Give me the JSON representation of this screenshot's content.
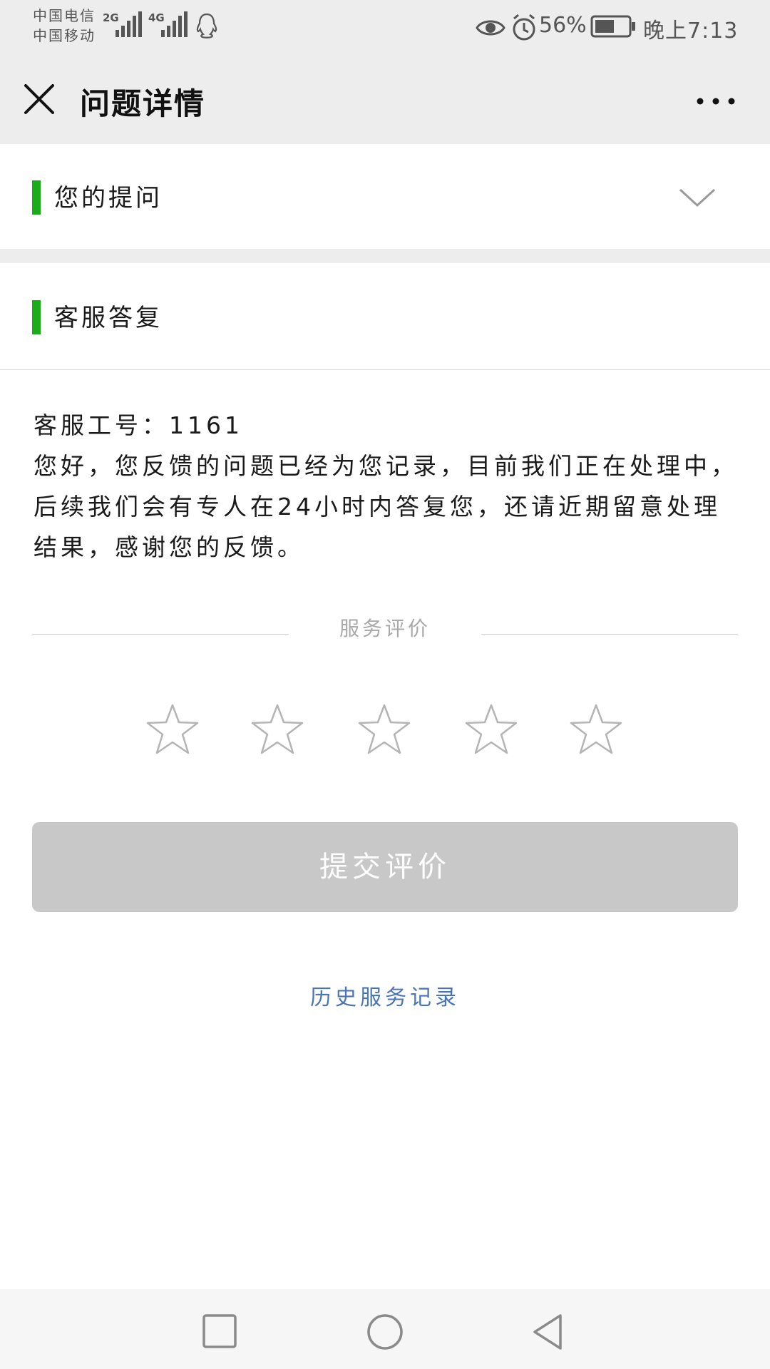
{
  "status_bar": {
    "carrier_1": "中国电信",
    "carrier_2": "中国移动",
    "network_1": "2G",
    "network_2": "4G",
    "battery": "56%",
    "time": "晚上7:13",
    "icons": [
      "signal-icon",
      "qq-icon",
      "eye-icon",
      "alarm-icon",
      "battery-icon"
    ]
  },
  "nav": {
    "title": "问题详情",
    "close_icon": "close-icon",
    "more_icon": "more-icon"
  },
  "question_section": {
    "title": "您的提问",
    "expand_icon": "chevron-down-icon"
  },
  "reply_section": {
    "title": "客服答复",
    "staff_id": "客服工号：1161",
    "message": "您好，您反馈的问题已经为您记录，目前我们正在处理中，后续我们会有专人在24小时内答复您，还请近期留意处理结果，感谢您的反馈。"
  },
  "rating": {
    "label": "服务评价",
    "max_stars": 5,
    "selected_stars": 0,
    "submit_label": "提交评价"
  },
  "history_link": "历史服务记录",
  "colors": {
    "accent_green": "#1aad19",
    "link_blue": "#4a74b8",
    "disabled_button": "#c8c8c8",
    "header_bg": "#ededed"
  }
}
